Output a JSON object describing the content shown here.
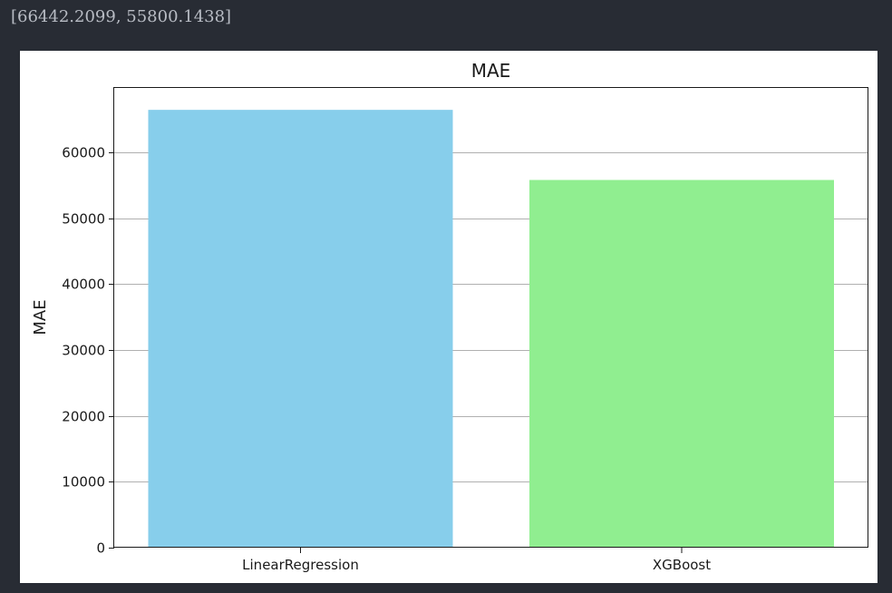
{
  "output": {
    "text": "[66442.2099, 55800.1438]"
  },
  "chart_data": {
    "type": "bar",
    "title": "MAE",
    "xlabel": "",
    "ylabel": "MAE",
    "categories": [
      "LinearRegression",
      "XGBoost"
    ],
    "values": [
      66442.2099,
      55800.1438
    ],
    "colors": [
      "#87ceeb",
      "#90ee90"
    ],
    "ylim": [
      0,
      69764.32
    ],
    "yticks": [
      0,
      10000,
      20000,
      30000,
      40000,
      50000,
      60000
    ],
    "ytick_labels": [
      "0",
      "10000",
      "20000",
      "30000",
      "40000",
      "50000",
      "60000"
    ],
    "grid": "y",
    "legend": false
  }
}
